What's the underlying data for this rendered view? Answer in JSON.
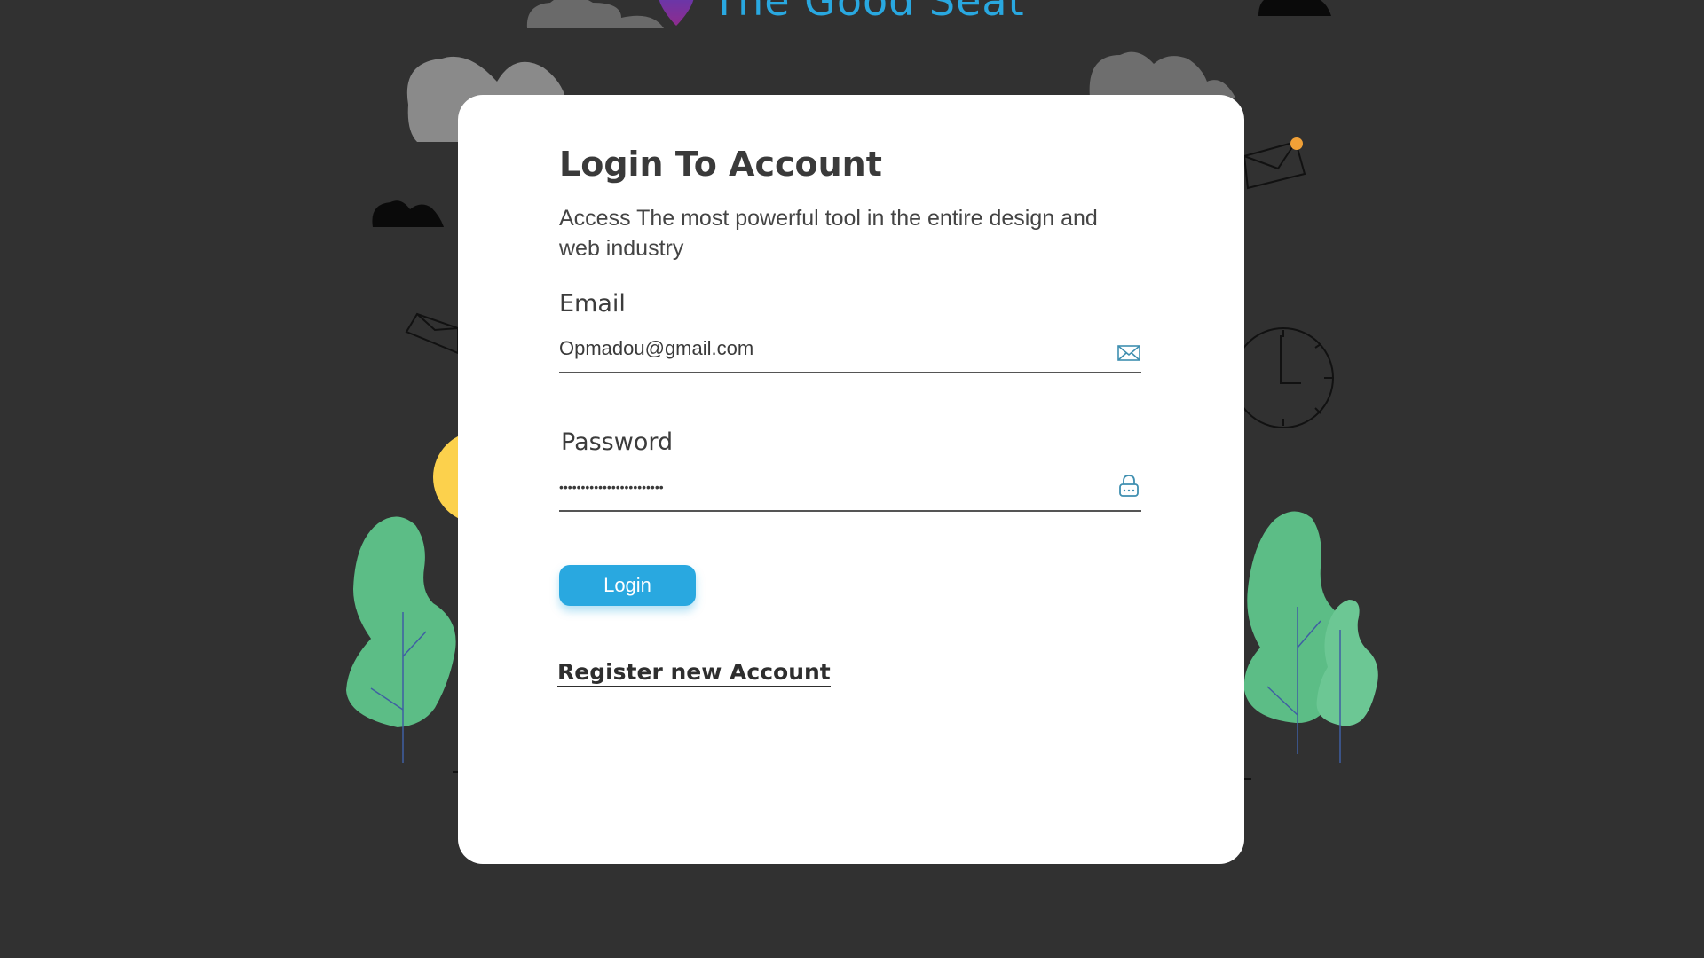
{
  "brand": {
    "name": "The Good Seat",
    "pin_icon": "location-pin-icon",
    "accent_color": "#29a8e0"
  },
  "login": {
    "title": "Login To Account",
    "subtitle": "Access The most powerful tool in the entire design and web industry",
    "email_label": "Email",
    "email_value": "Opmadou@gmail.com",
    "email_icon": "envelope-icon",
    "password_label": "Password",
    "password_value": "••••••••••••••••••••••••",
    "password_icon": "lock-icon",
    "login_button": "Login",
    "register_link": "Register new Account"
  },
  "colors": {
    "background": "#313131",
    "card": "#ffffff",
    "button": "#29a8e0",
    "tree": "#5cbd86",
    "sun": "#fcd14c",
    "accent_dot": "#f0a037"
  }
}
